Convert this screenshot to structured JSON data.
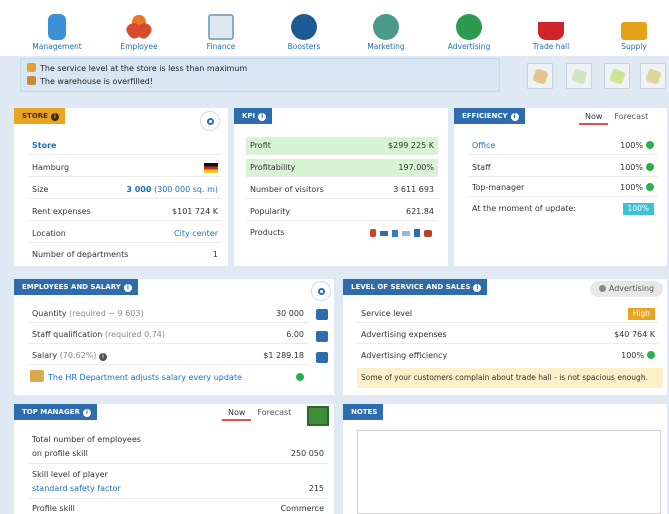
{
  "nav": [
    {
      "label": "Management",
      "color": "#3b8fd6"
    },
    {
      "label": "Employee",
      "color": "#d64a2e"
    },
    {
      "label": "Finance",
      "color": "#8fa9bf"
    },
    {
      "label": "Boosters",
      "color": "#1e5a96"
    },
    {
      "label": "Marketing",
      "color": "#4a9a8c"
    },
    {
      "label": "Advertising",
      "color": "#2e9a4e"
    },
    {
      "label": "Trade hall",
      "color": "#d0242a"
    },
    {
      "label": "Supply",
      "color": "#e5a21b"
    }
  ],
  "alerts": {
    "service": "The service level at the store is less than maximum",
    "warehouse": "The warehouse is overfilled!"
  },
  "store": {
    "tab": "STORE",
    "title": "Store",
    "city": "Hamburg",
    "size_label": "Size",
    "size_value": "3 000",
    "size_extra": "(300 000 sq. m)",
    "rent_label": "Rent expenses",
    "rent_value": "$101 724 K",
    "location_label": "Location",
    "location_value": "City center",
    "departments_label": "Number of departments",
    "departments_value": "1"
  },
  "kpi": {
    "tab": "KPI",
    "profit_label": "Profit",
    "profit_value": "$299 225 K",
    "profitability_label": "Profitability",
    "profitability_value": "197.00%",
    "visitors_label": "Number of visitors",
    "visitors_value": "3 611 693",
    "popularity_label": "Popularity",
    "popularity_value": "621.84",
    "products_label": "Products"
  },
  "efficiency": {
    "tab": "EFFICIENCY",
    "now": "Now",
    "forecast": "Forecast",
    "office_label": "Office",
    "office_value": "100%",
    "staff_label": "Staff",
    "staff_value": "100%",
    "top_label": "Top-manager",
    "top_value": "100%",
    "update_label": "At the moment of update:",
    "update_value": "100%"
  },
  "employees": {
    "tab": "EMPLOYEES AND SALARY",
    "quantity_label": "Quantity",
    "quantity_req": "(required ~ 9 603)",
    "quantity_value": "30 000",
    "qual_label": "Staff qualification",
    "qual_req": "(required 0.74)",
    "qual_value": "6.00",
    "salary_label": "Salary",
    "salary_pct": "(70.62%)",
    "salary_value": "$1 289.18",
    "hr_note": "The HR Department adjusts salary every update"
  },
  "service": {
    "tab": "LEVEL OF SERVICE AND SALES",
    "advertising_btn": "Advertising",
    "level_label": "Service level",
    "level_value": "High",
    "adexp_label": "Advertising expenses",
    "adexp_value": "$40 764 K",
    "adeff_label": "Advertising efficiency",
    "adeff_value": "100%",
    "complaint": "Some of your customers complain about trade hall - is not spacious enough."
  },
  "topmanager": {
    "tab": "TOP MANAGER",
    "now": "Now",
    "forecast": "Forecast",
    "total_label_1": "Total number of employees",
    "total_label_2": "on profile skill",
    "total_value": "250 050",
    "skill_label": "Skill level of player",
    "skill_link": "standard safety factor",
    "skill_value": "215",
    "profile_label": "Profile skill",
    "profile_value": "Commerce"
  },
  "notes": {
    "tab": "NOTES"
  }
}
